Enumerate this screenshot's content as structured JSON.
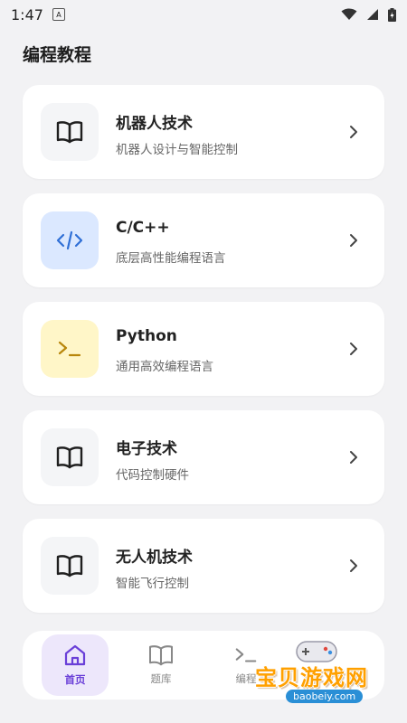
{
  "status": {
    "time": "1:47",
    "notif_letter": "A"
  },
  "page": {
    "title": "编程教程"
  },
  "courses": [
    {
      "title": "机器人技术",
      "subtitle": "机器人设计与智能控制",
      "icon": "book-icon",
      "icon_bg": "#f4f5f7",
      "icon_color": "#1f1f1f"
    },
    {
      "title": "C/C++",
      "subtitle": "底层高性能编程语言",
      "icon": "code-icon",
      "icon_bg": "#dbe8ff",
      "icon_color": "#2f6fd6"
    },
    {
      "title": "Python",
      "subtitle": "通用高效编程语言",
      "icon": "terminal-icon",
      "icon_bg": "#fff6c8",
      "icon_color": "#b8860b"
    },
    {
      "title": "电子技术",
      "subtitle": "代码控制硬件",
      "icon": "book-icon",
      "icon_bg": "#f4f5f7",
      "icon_color": "#1f1f1f"
    },
    {
      "title": "无人机技术",
      "subtitle": "智能飞行控制",
      "icon": "book-icon",
      "icon_bg": "#f4f5f7",
      "icon_color": "#1f1f1f"
    }
  ],
  "nav": {
    "home": "首页",
    "questions": "题库",
    "coding": "编程"
  },
  "watermark": {
    "text": "宝贝游戏网",
    "url": "baobeiy.com"
  },
  "colors": {
    "accent": "#6a3fd8",
    "accent_bg": "#ede7fb",
    "background": "#f2f2f4"
  }
}
